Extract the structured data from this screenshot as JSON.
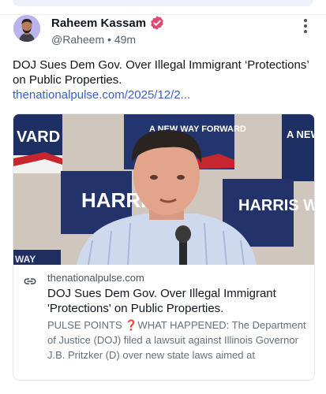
{
  "post": {
    "author_name": "Raheem Kassam",
    "handle": "@Raheem",
    "separator": "•",
    "time": "49m",
    "text": "DOJ Sues Dem Gov. Over Illegal Immigrant ‘Protections’ on Public Properties.",
    "link_text": "thenationalpulse.com/2025/12/2..."
  },
  "card": {
    "domain": "thenationalpulse.com",
    "title": "DOJ Sues Dem Gov. Over Illegal Immigrant 'Protections' on Public Properties.",
    "description": "PULSE POINTS ❓WHAT HAPPENED: The Department of Justice (DOJ) filed a lawsuit against Illinois Governor J.B. Pritzker (D) over new state laws aimed at",
    "image_signs": [
      "VARD",
      "A NEW WAY FORWARD",
      "HARRIS",
      "HARRIS WALZ",
      "A NEW",
      "WAY"
    ]
  },
  "icons": {
    "verified": "verified-badge-icon",
    "menu": "more-vertical-icon",
    "link": "link-icon"
  },
  "colors": {
    "accent": "#e2486e",
    "link": "#3a5fbf",
    "avatar_bg": "#b9b4ee"
  }
}
